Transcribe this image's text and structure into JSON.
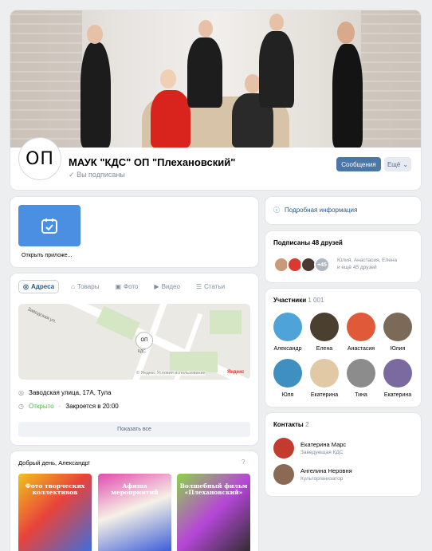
{
  "header": {
    "avatar_text": "ОП",
    "group_name": "МАУК \"КДС\" ОП \"Плехановский\"",
    "subscribed": "Вы подписаны",
    "message_btn": "Сообщения",
    "more_btn": "Ещё"
  },
  "app": {
    "label": "Открыть приложе..."
  },
  "address": {
    "tabs": [
      "Адреса",
      "Товары",
      "Фото",
      "Видео",
      "Статьи"
    ],
    "map": {
      "street_label": "Заводская ул.",
      "marker": "ОП",
      "marker_sub": "КДС",
      "terms": "© Яндекс Условия использования",
      "brand": "Яндекс"
    },
    "street": "Заводская улица, 17А, Тула",
    "status_open": "Открыто",
    "status_close": "Закроется в 20:00",
    "show_all": "Показать все"
  },
  "greeting": {
    "title": "Добрый день, Александр!",
    "posters": [
      "Фото творческих коллективов",
      "Афиша мероприятий",
      "Волшебный фильм «Плехановский»"
    ]
  },
  "info": {
    "label": "Подробная информация"
  },
  "friends": {
    "title": "Подписаны 48 друзей",
    "more_badge": "+45",
    "names_line1": "Юлия, Анастасия, Елена",
    "names_line2": "и ещё 45 друзей"
  },
  "members": {
    "title": "Участники",
    "count": "1 001",
    "people": [
      "Александр",
      "Елена",
      "Анастасия",
      "Юлия",
      "Юля",
      "Екатерина",
      "Тина",
      "Екатерина"
    ]
  },
  "contacts": {
    "title": "Контакты",
    "count": "2",
    "items": [
      {
        "name": "Екатерина Марс",
        "role": "Заведующая КДС"
      },
      {
        "name": "Ангелина Неровня",
        "role": "Культорганизатор"
      }
    ]
  },
  "colors": {
    "primary": "#4a76a8",
    "accent_open": "#4bb34b",
    "app_icon": "#4b8fe2"
  }
}
